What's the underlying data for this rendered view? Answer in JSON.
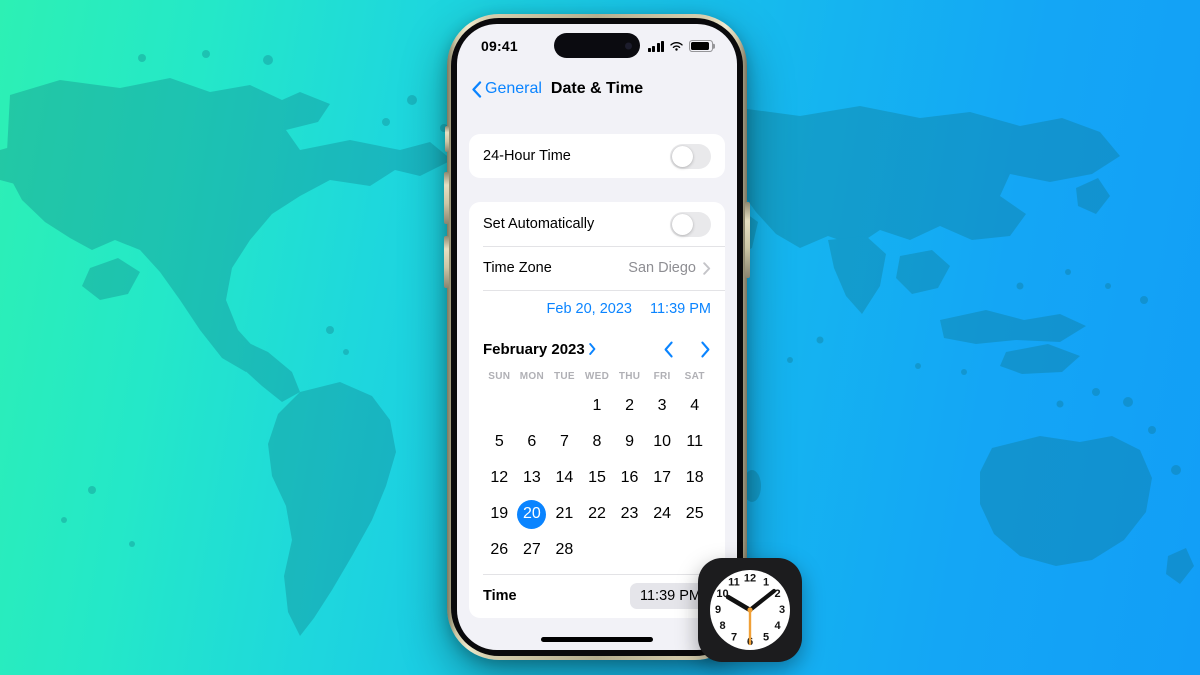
{
  "background": {
    "gradient_from": "#2df0b4",
    "gradient_to": "#129ef7",
    "map_fill": "#0f6f7e",
    "name": "world-map-gradient"
  },
  "device": {
    "frame_color": "#d6cfae",
    "screen_bg": "#f2f2f7"
  },
  "status_bar": {
    "time": "09:41",
    "signal_icon": "cellular-signal-icon",
    "wifi_icon": "wifi-icon",
    "battery_icon": "battery-icon"
  },
  "nav": {
    "back_label": "General",
    "title": "Date & Time",
    "back_icon": "chevron-left-icon"
  },
  "settings": {
    "hour24": {
      "label": "24-Hour Time",
      "toggle_state": "off"
    },
    "set_automatically": {
      "label": "Set Automatically",
      "toggle_state": "off"
    },
    "time_zone": {
      "label": "Time Zone",
      "value": "San Diego",
      "disclosure_icon": "chevron-right-icon"
    },
    "date_button": "Feb 20, 2023",
    "time_button": "11:39 PM"
  },
  "calendar": {
    "month_label": "February 2023",
    "month_expand_icon": "chevron-right-icon",
    "prev_icon": "chevron-left-icon",
    "next_icon": "chevron-right-icon",
    "day_headers": [
      "SUN",
      "MON",
      "TUE",
      "WED",
      "THU",
      "FRI",
      "SAT"
    ],
    "leading_blanks": 3,
    "days": [
      1,
      2,
      3,
      4,
      5,
      6,
      7,
      8,
      9,
      10,
      11,
      12,
      13,
      14,
      15,
      16,
      17,
      18,
      19,
      20,
      21,
      22,
      23,
      24,
      25,
      26,
      27,
      28
    ],
    "selected_day": 20,
    "selected_color": "#0a84ff"
  },
  "time_row": {
    "label": "Time",
    "value": "11:39 PM"
  },
  "clock_icon": {
    "name": "clock-app-icon",
    "body_color": "#1c1c1e",
    "face_color": "#ffffff",
    "second_hand_color": "#f0a037",
    "hour_marks": [
      "12",
      "1",
      "2",
      "3",
      "4",
      "5",
      "6",
      "7",
      "8",
      "9",
      "10",
      "11"
    ],
    "hour_hand_points_to": 10,
    "minute_hand_points_to": 2,
    "second_hand_points_to": 6
  }
}
